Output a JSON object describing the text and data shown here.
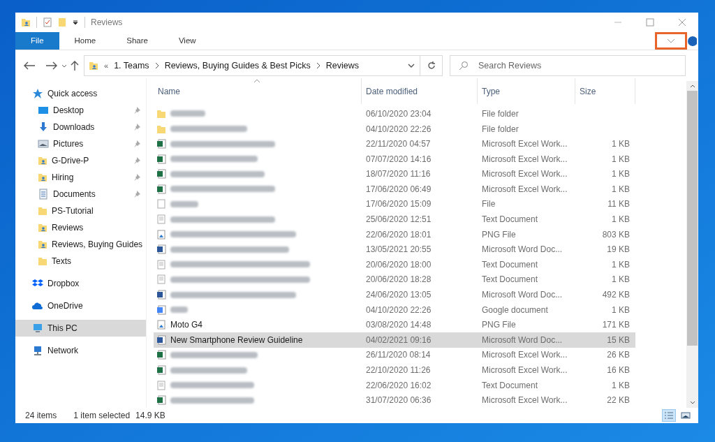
{
  "window": {
    "title": "Reviews"
  },
  "ribbon": {
    "tabs": [
      {
        "label": "File",
        "selected": true
      },
      {
        "label": "Home",
        "selected": false
      },
      {
        "label": "Share",
        "selected": false
      },
      {
        "label": "View",
        "selected": false
      }
    ],
    "expand_highlighted": true
  },
  "address": {
    "path": [
      "1. Teams",
      "Reviews, Buying Guides & Best Picks",
      "Reviews"
    ],
    "overflow": "«"
  },
  "search": {
    "placeholder": "Search Reviews"
  },
  "sidebar": {
    "items": [
      {
        "label": "Quick access",
        "kind": "star",
        "selected": false,
        "children": [
          {
            "label": "Desktop",
            "kind": "desktop",
            "pinned": true,
            "selected": false
          },
          {
            "label": "Downloads",
            "kind": "download",
            "pinned": true,
            "selected": false
          },
          {
            "label": "Pictures",
            "kind": "pictures",
            "pinned": true,
            "selected": false
          },
          {
            "label": "G-Drive-P",
            "kind": "folder-shared",
            "pinned": true,
            "selected": false
          },
          {
            "label": "Hiring",
            "kind": "folder-shared",
            "pinned": true,
            "selected": false
          },
          {
            "label": "Documents",
            "kind": "documents",
            "pinned": true,
            "selected": false
          },
          {
            "label": "PS-Tutorial",
            "kind": "folder",
            "pinned": false,
            "selected": false
          },
          {
            "label": "Reviews",
            "kind": "folder-shared",
            "pinned": false,
            "selected": false
          },
          {
            "label": "Reviews, Buying Guides",
            "kind": "folder-shared",
            "pinned": false,
            "selected": false
          },
          {
            "label": "Texts",
            "kind": "folder",
            "pinned": false,
            "selected": false
          }
        ]
      },
      {
        "label": "Dropbox",
        "kind": "dropbox",
        "selected": false
      },
      {
        "label": "OneDrive",
        "kind": "cloud",
        "selected": false
      },
      {
        "label": "This PC",
        "kind": "pc",
        "selected": true
      },
      {
        "label": "Network",
        "kind": "network",
        "selected": false
      }
    ]
  },
  "table": {
    "columns": [
      "Name",
      "Date modified",
      "Type",
      "Size"
    ],
    "rows": [
      {
        "blurred": true,
        "kind": "folder",
        "date": "06/10/2020 23:04",
        "type": "File folder",
        "selected": false
      },
      {
        "blurred": true,
        "kind": "folder",
        "date": "04/10/2020 22:26",
        "type": "File folder",
        "selected": false
      },
      {
        "blurred": true,
        "kind": "excel",
        "date": "22/11/2020 04:57",
        "type": "Microsoft Excel Work...",
        "size": "1 KB",
        "selected": false
      },
      {
        "blurred": true,
        "kind": "excel",
        "date": "07/07/2020 14:16",
        "type": "Microsoft Excel Work...",
        "size": "1 KB",
        "selected": false
      },
      {
        "blurred": true,
        "kind": "excel",
        "date": "18/07/2020 11:16",
        "type": "Microsoft Excel Work...",
        "size": "1 KB",
        "selected": false
      },
      {
        "blurred": true,
        "kind": "excel",
        "date": "17/06/2020 06:49",
        "type": "Microsoft Excel Work...",
        "size": "1 KB",
        "selected": false
      },
      {
        "blurred": true,
        "kind": "file",
        "date": "17/06/2020 15:09",
        "type": "File",
        "size": "11 KB",
        "selected": false
      },
      {
        "blurred": true,
        "kind": "text",
        "date": "25/06/2020 12:51",
        "type": "Text Document",
        "size": "1 KB",
        "selected": false
      },
      {
        "blurred": true,
        "kind": "image",
        "date": "22/06/2020 18:01",
        "type": "PNG File",
        "size": "803 KB",
        "selected": false
      },
      {
        "blurred": true,
        "kind": "word",
        "date": "13/05/2021 20:55",
        "type": "Microsoft Word Doc...",
        "size": "19 KB",
        "selected": false
      },
      {
        "blurred": true,
        "kind": "text",
        "date": "20/06/2020 18:00",
        "type": "Text Document",
        "size": "1 KB",
        "selected": false
      },
      {
        "blurred": true,
        "kind": "text",
        "date": "20/06/2020 18:28",
        "type": "Text Document",
        "size": "1 KB",
        "selected": false
      },
      {
        "blurred": true,
        "kind": "word",
        "date": "24/06/2020 13:05",
        "type": "Microsoft Word Doc...",
        "size": "492 KB",
        "selected": false
      },
      {
        "blurred": true,
        "kind": "gdoc",
        "date": "04/10/2020 22:26",
        "type": "Google document",
        "size": "1 KB",
        "selected": false
      },
      {
        "blurred": false,
        "name": "Moto G4",
        "kind": "image",
        "date": "03/08/2020 14:48",
        "type": "PNG File",
        "size": "171 KB",
        "selected": false
      },
      {
        "blurred": false,
        "name": "New Smartphone Review Guideline",
        "kind": "word",
        "date": "04/02/2021 09:16",
        "type": "Microsoft Word Doc...",
        "size": "15 KB",
        "selected": true
      },
      {
        "blurred": true,
        "kind": "excel",
        "date": "26/11/2020 08:14",
        "type": "Microsoft Excel Work...",
        "size": "26 KB",
        "selected": false
      },
      {
        "blurred": true,
        "kind": "excel",
        "date": "22/10/2020 11:26",
        "type": "Microsoft Excel Work...",
        "size": "16 KB",
        "selected": false
      },
      {
        "blurred": true,
        "kind": "text",
        "date": "22/06/2020 16:02",
        "type": "Text Document",
        "size": "1 KB",
        "selected": false
      },
      {
        "blurred": true,
        "kind": "excel",
        "date": "31/07/2020 06:36",
        "type": "Microsoft Excel Work...",
        "size": "22 KB",
        "selected": false
      }
    ]
  },
  "status_bar": {
    "count": "24 items",
    "selection": "1 item selected",
    "size": "14.9 KB"
  },
  "view_modes": [
    {
      "kind": "details",
      "selected": true
    },
    {
      "kind": "tiles",
      "selected": false
    }
  ]
}
